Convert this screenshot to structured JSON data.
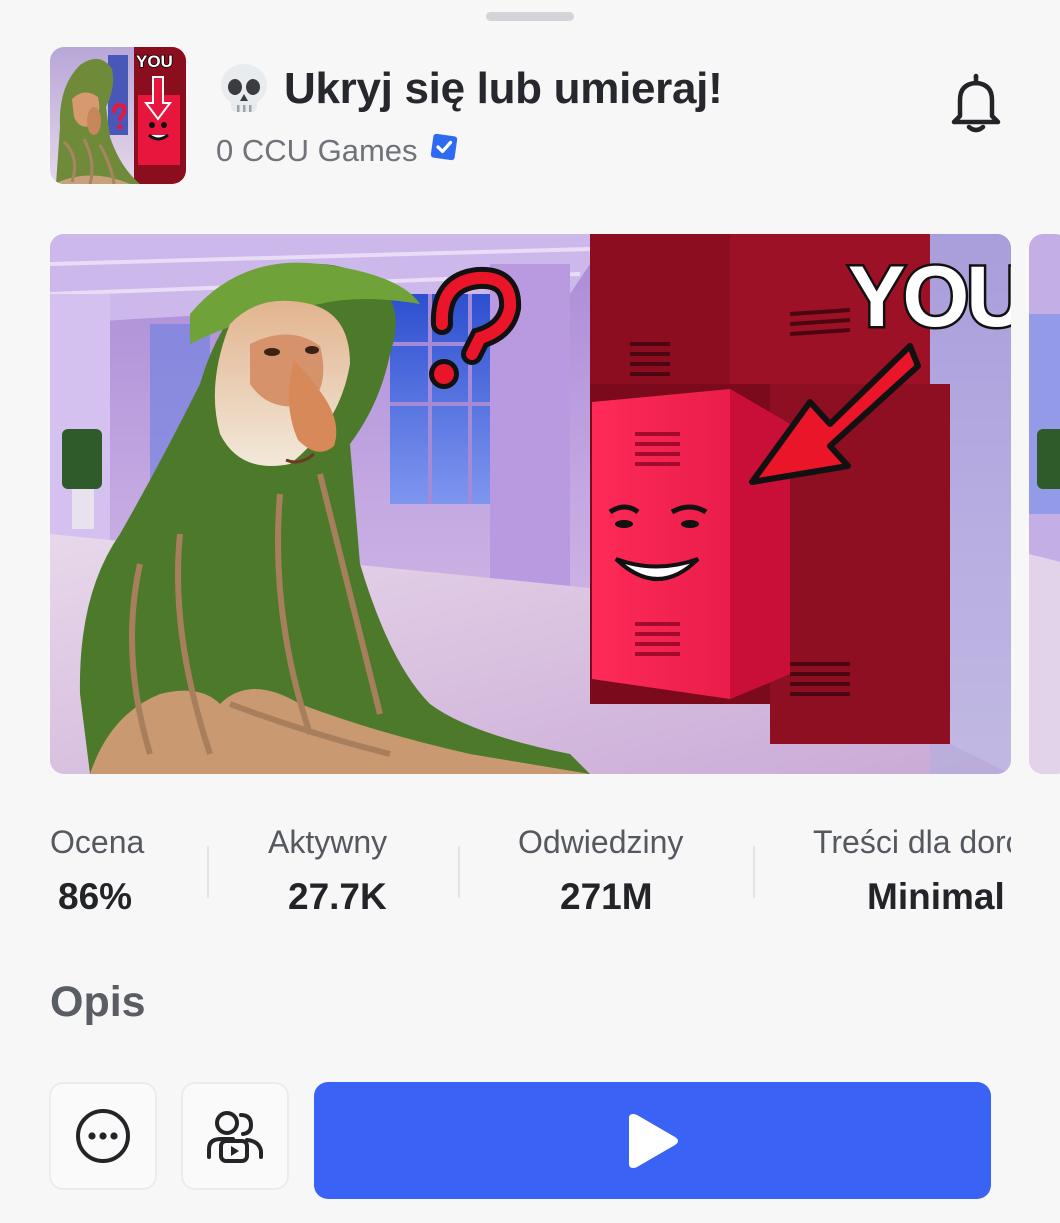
{
  "header": {
    "title": "Ukryj się lub umieraj!",
    "creator": "0 CCU Games",
    "thumbnail_text": "YOU"
  },
  "hero": {
    "overlay_text": "YOU"
  },
  "stats": [
    {
      "label": "Ocena",
      "value": "86%"
    },
    {
      "label": "Aktywny",
      "value": "27.7K"
    },
    {
      "label": "Odwiedziny",
      "value": "271M"
    },
    {
      "label": "Treści dla dorosłych",
      "value": "Minimal"
    }
  ],
  "description": {
    "title": "Opis"
  },
  "colors": {
    "accent": "#3a63f5",
    "verified": "#2e6bf2",
    "locker_red": "#e0143a"
  },
  "icons": {
    "skull": "skull-emoji",
    "notify": "bell-icon",
    "more": "more-icon",
    "party": "party-icon",
    "play": "play-icon"
  }
}
